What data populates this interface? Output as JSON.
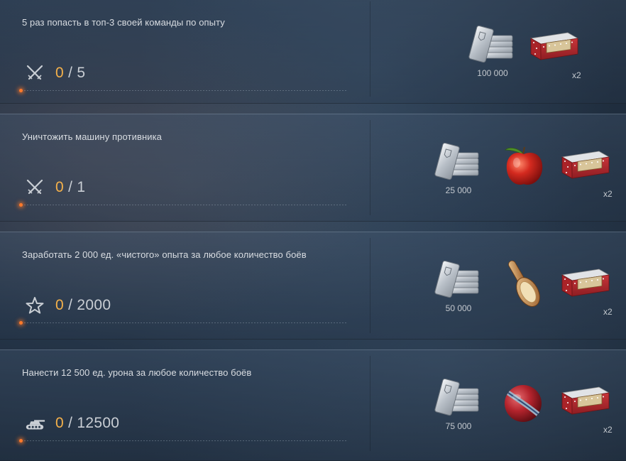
{
  "tasks": [
    {
      "title": "5 раз попасть в топ-3 своей команды по опыту",
      "progress_icon": "crossed-swords-icon",
      "progress_current": "0",
      "progress_total": "/ 5",
      "rewards": [
        {
          "type": "silver-icon",
          "label": "100 000"
        },
        {
          "type": "gift-box-icon",
          "label": "x2"
        }
      ]
    },
    {
      "title": "Уничтожить машину противника",
      "progress_icon": "crossed-swords-icon",
      "progress_current": "0",
      "progress_total": "/ 1",
      "rewards": [
        {
          "type": "silver-icon",
          "label": "25 000"
        },
        {
          "type": "apple-icon",
          "label": ""
        },
        {
          "type": "gift-box-icon",
          "label": "x2"
        }
      ]
    },
    {
      "title": "Заработать 2 000 ед. «чистого» опыта за любое количество боёв",
      "progress_icon": "star-icon",
      "progress_current": "0",
      "progress_total": "/ 2000",
      "rewards": [
        {
          "type": "silver-icon",
          "label": "50 000"
        },
        {
          "type": "brush-icon",
          "label": ""
        },
        {
          "type": "gift-box-icon",
          "label": "x2"
        }
      ]
    },
    {
      "title": "Нанести 12 500 ед. урона за любое количество боёв",
      "progress_icon": "tank-icon",
      "progress_current": "0",
      "progress_total": "/ 12500",
      "rewards": [
        {
          "type": "silver-icon",
          "label": "75 000"
        },
        {
          "type": "ball-icon",
          "label": ""
        },
        {
          "type": "gift-box-icon",
          "label": "x2"
        }
      ]
    }
  ]
}
